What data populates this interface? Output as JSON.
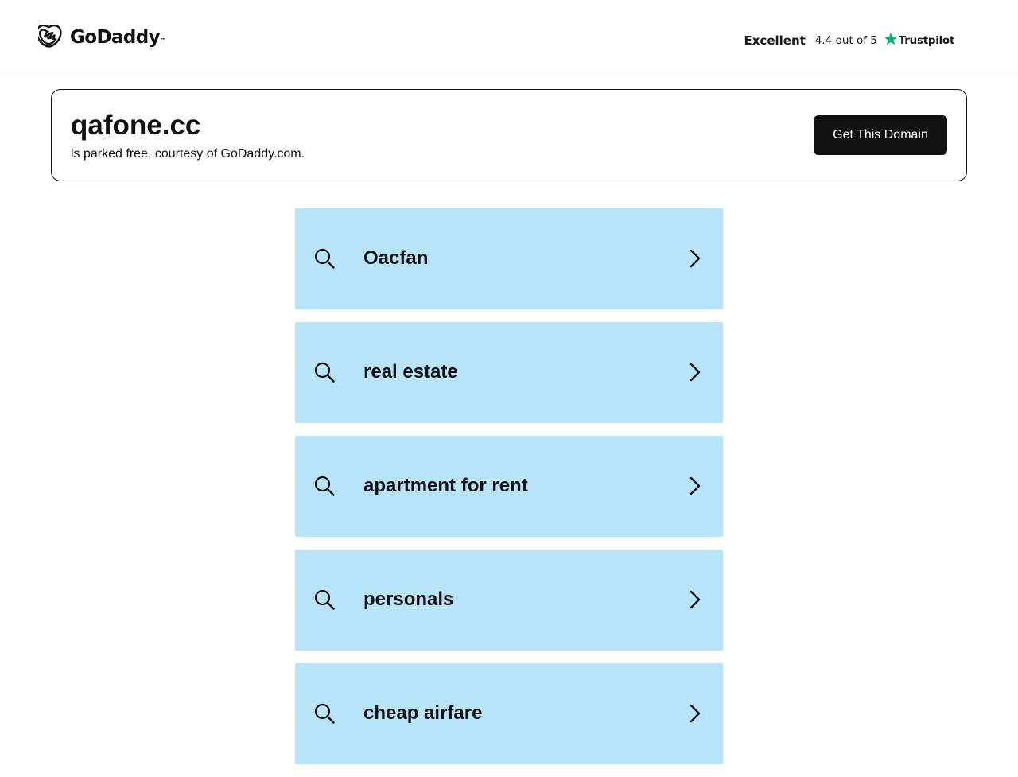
{
  "header": {
    "logo_text": "GoDaddy",
    "logo_tm": "™",
    "rating": {
      "word": "Excellent",
      "score": "4.4 out of 5",
      "provider": "Trustpilot",
      "star_color": "#00b67a"
    }
  },
  "domain_card": {
    "domain": "qafone.cc",
    "subtitle": "is parked free, courtesy of GoDaddy.com.",
    "cta_label": "Get This Domain"
  },
  "results": [
    {
      "label": "Oacfan"
    },
    {
      "label": "real estate"
    },
    {
      "label": "apartment for rent"
    },
    {
      "label": "personals"
    },
    {
      "label": "cheap airfare"
    }
  ],
  "colors": {
    "result_bg": "#b7e4f9",
    "cta_bg": "#111111",
    "text": "#111111"
  }
}
